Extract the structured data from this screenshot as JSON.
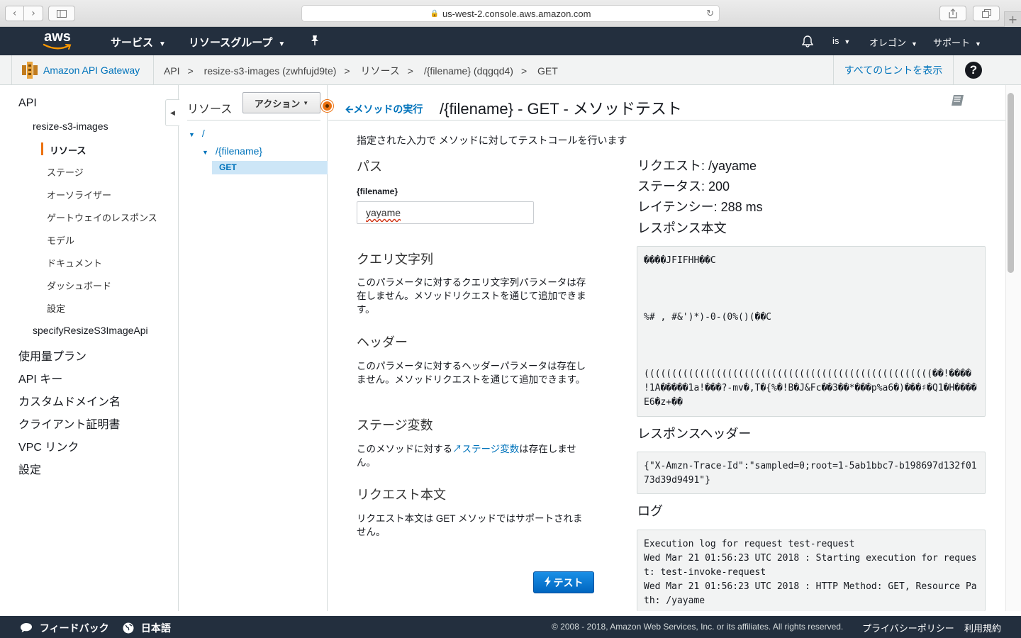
{
  "browser": {
    "url": "us-west-2.console.aws.amazon.com"
  },
  "topnav": {
    "logo": "aws",
    "services": "サービス",
    "resource_groups": "リソースグループ",
    "account": "is",
    "region": "オレゴン",
    "support": "サポート"
  },
  "service_bar": {
    "service_name": "Amazon API Gateway",
    "breadcrumbs": [
      "API",
      "resize-s3-images (zwhfujd9te)",
      "リソース",
      "/{filename} (dqgqd4)",
      "GET"
    ],
    "separator": ">",
    "show_hints": "すべてのヒントを表示",
    "help": "?"
  },
  "leftnav": {
    "api": "API",
    "api_name": "resize-s3-images",
    "resources": "リソース",
    "stages": "ステージ",
    "authorizers": "オーソライザー",
    "gateway_responses": "ゲートウェイのレスポンス",
    "models": "モデル",
    "documentation": "ドキュメント",
    "dashboard": "ダッシュボード",
    "settings": "設定",
    "other_api": "specifyResizeS3ImageApi",
    "usage_plans": "使用量プラン",
    "api_keys": "API キー",
    "custom_domains": "カスタムドメイン名",
    "client_certs": "クライアント証明書",
    "vpc_links": "VPC リンク",
    "global_settings": "設定"
  },
  "resource_tree": {
    "title": "リソース",
    "actions": "アクション",
    "root": "/",
    "child": "/{filename}",
    "method": "GET"
  },
  "main": {
    "back_link": "メソッドの実行",
    "title": "/{filename} - GET - メソッドテスト",
    "description": "指定された入力で メソッドに対してテストコールを行います",
    "path_heading": "パス",
    "path_param_label": "{filename}",
    "path_param_value": "yayame",
    "query_heading": "クエリ文字列",
    "query_text": "このパラメータに対するクエリ文字列パラメータは存在しません。メソッドリクエストを通じて追加できます。",
    "header_heading": "ヘッダー",
    "header_text": "このパラメータに対するヘッダーパラメータは存在しません。メソッドリクエストを通じて追加できます。",
    "stage_heading": "ステージ変数",
    "stage_text_pre": "このメソッドに対する",
    "stage_link": "ステージ変数",
    "stage_text_post": "は存在しません。",
    "body_heading": "リクエスト本文",
    "body_text": "リクエスト本文は GET メソッドではサポートされません。",
    "test_button": "テスト"
  },
  "result": {
    "request": "リクエスト: /yayame",
    "status": "ステータス: 200",
    "latency": "レイテンシー: 288 ms",
    "response_body_heading": "レスポンス本文",
    "response_body": "����JFIFHH��C\n\n\n\n%# , #&')*)-0-(0%()(��C\n\n\n\n((((((((((((((((((((((((((((((((((((((((((((((((((((��!���� !1A�����1a!���?-mv�,T�{%�!B�J&Fc��3��*���p%a6�)���♯�Q1�H����E6�z+��",
    "response_headers_heading": "レスポンスヘッダー",
    "response_headers": "{\"X-Amzn-Trace-Id\":\"sampled=0;root=1-5ab1bbc7-b198697d132f0173d39d9491\"}",
    "logs_heading": "ログ",
    "logs": "Execution log for request test-request\nWed Mar 21 01:56:23 UTC 2018 : Starting execution for request: test-invoke-request\nWed Mar 21 01:56:23 UTC 2018 : HTTP Method: GET, Resource Path: /yayame"
  },
  "footer": {
    "feedback": "フィードバック",
    "language": "日本語",
    "copyright": "© 2008 - 2018, Amazon Web Services, Inc. or its affiliates. All rights reserved.",
    "privacy": "プライバシーポリシー",
    "terms": "利用規約"
  },
  "colors": {
    "nav_bg": "#232f3e",
    "link": "#0073bb",
    "accent": "#ec7211",
    "test_button": "#0073bb"
  }
}
